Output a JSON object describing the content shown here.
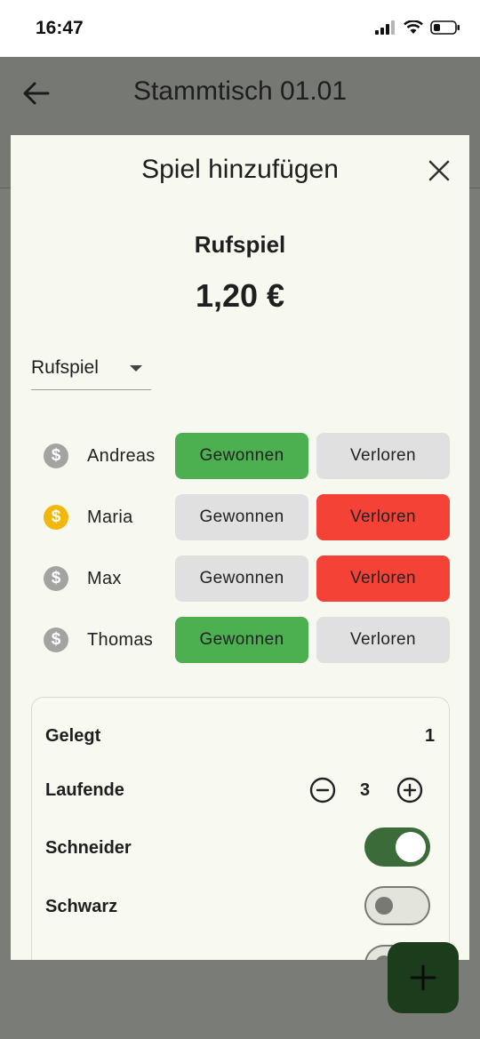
{
  "status_bar": {
    "time": "16:47"
  },
  "app_bar": {
    "title": "Stammtisch 01.01"
  },
  "dialog": {
    "title": "Spiel hinzufügen",
    "game_type_label": "Rufspiel",
    "amount": "1,20 €",
    "game_type_select": {
      "value": "Rufspiel"
    },
    "players": [
      {
        "name": "Andreas",
        "coin": "grey",
        "won_label": "Gewonnen",
        "lost_label": "Verloren",
        "result": "won"
      },
      {
        "name": "Maria",
        "coin": "gold",
        "won_label": "Gewonnen",
        "lost_label": "Verloren",
        "result": "lost"
      },
      {
        "name": "Max",
        "coin": "grey",
        "won_label": "Gewonnen",
        "lost_label": "Verloren",
        "result": "lost"
      },
      {
        "name": "Thomas",
        "coin": "grey",
        "won_label": "Gewonnen",
        "lost_label": "Verloren",
        "result": "won"
      }
    ],
    "options": {
      "gelegt": {
        "label": "Gelegt",
        "value": "1"
      },
      "laufende": {
        "label": "Laufende",
        "value": "3"
      },
      "schneider": {
        "label": "Schneider",
        "enabled": true
      },
      "schwarz": {
        "label": "Schwarz",
        "enabled": false
      }
    }
  },
  "colors": {
    "won": "#4caf50",
    "lost": "#f44336",
    "neutral_button": "#e0e0e0",
    "toggle_on": "#3b6b38",
    "coin_gold": "#f2b70d",
    "coin_grey": "#a3a4a2",
    "fab": "#1c3d1b"
  },
  "icons": {
    "back": "arrow-left-icon",
    "close": "close-icon",
    "coin": "dollar-coin-icon",
    "dropdown": "caret-down-icon",
    "decrement": "minus-circle-icon",
    "increment": "plus-circle-icon",
    "fab": "plus-icon"
  }
}
